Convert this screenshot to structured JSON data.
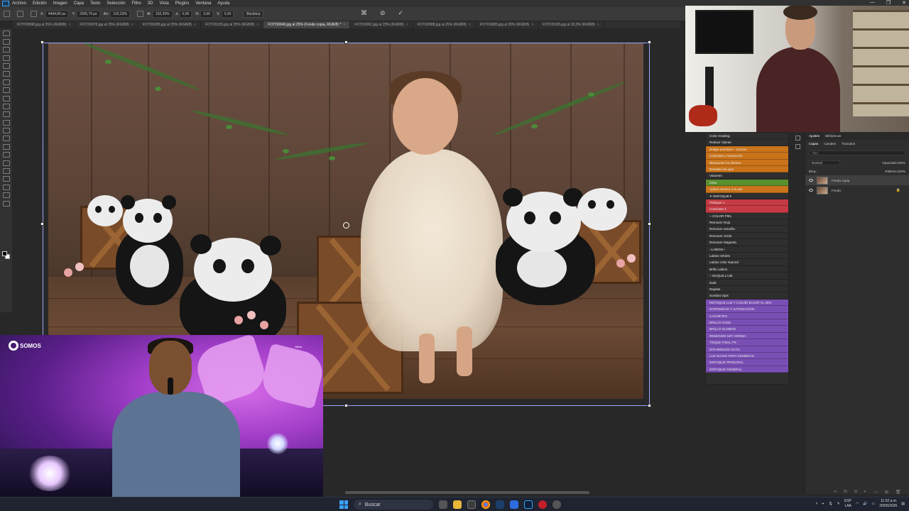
{
  "menu": [
    "Archivo",
    "Edición",
    "Imagen",
    "Capa",
    "Texto",
    "Selección",
    "Filtro",
    "3D",
    "Vista",
    "Plugins",
    "Ventana",
    "Ayuda"
  ],
  "window_controls": [
    "—",
    "❐",
    "✕"
  ],
  "options": {
    "x": "4494,80 px",
    "y": "2205,79 px",
    "w": "102,33%",
    "h": "102,33%",
    "angle": "0,00",
    "h_skew": "0,00",
    "v_skew": "0,00",
    "interp": "Bicúbica"
  },
  "tabs": [
    {
      "label": "FOTO9998.jpg al 25% (RGB/8)",
      "active": false
    },
    {
      "label": "FOTO0978.jpg al 25% (RGB/8)",
      "active": false
    },
    {
      "label": "FOTO0085.jpg al 25% (RGB/8)",
      "active": false
    },
    {
      "label": "FOTO0105.jpg al 25% (RGB/8)",
      "active": false
    },
    {
      "label": "FOTO0049.jpg al 25% (Fondo copia, RGB/8) *",
      "active": true
    },
    {
      "label": "FOTO0062.jpg al 25% (RGB/8)",
      "active": false
    },
    {
      "label": "FOTO0088.jpg al 25% (RGB/8)",
      "active": false
    },
    {
      "label": "FOTO0085.jpg al 25% (RGB/8)",
      "active": false
    },
    {
      "label": "FOTO0105.jpg al 33,3% (RGB/8)",
      "active": false
    }
  ],
  "actions": [
    {
      "label": "Color Grading",
      "color": "#2e2e2e"
    },
    {
      "label": "Reducir Ojeras",
      "color": "#2e2e2e"
    },
    {
      "label": "Dodge and Burn - Curvas",
      "color": "#c9731a"
    },
    {
      "label": "Contraste y Saturación",
      "color": "#c9731a"
    },
    {
      "label": "Blanquear los dientes",
      "color": "#c9731a"
    },
    {
      "label": "Resaltar los ojos",
      "color": "#c9731a"
    },
    {
      "label": "Volumen",
      "color": "#2e2e2e"
    },
    {
      "label": "Glow",
      "color": "#5a8f2e"
    },
    {
      "label": "Aplicar textura a la piel",
      "color": "#c9731a"
    },
    {
      "label": "✦ ENFOQUE✦",
      "color": "#2e2e2e"
    },
    {
      "label": "Pelisque 1",
      "color": "#c53a44"
    },
    {
      "label": "Contraste 2",
      "color": "#c53a44"
    },
    {
      "label": "~ COLOR PIEL",
      "color": "#2e2e2e"
    },
    {
      "label": "Remover Rojo",
      "color": "#2e2e2e"
    },
    {
      "label": "Remover amarillo",
      "color": "#2e2e2e"
    },
    {
      "label": "Remover verde",
      "color": "#2e2e2e"
    },
    {
      "label": "Remover Magenta",
      "color": "#2e2e2e"
    },
    {
      "label": "~LABIOS~",
      "color": "#2e2e2e"
    },
    {
      "label": "Labios Verdes",
      "color": "#2e2e2e"
    },
    {
      "label": "Labios color Natural",
      "color": "#2e2e2e"
    },
    {
      "label": "Brillo Labios",
      "color": "#2e2e2e"
    },
    {
      "label": "~ MAQUILLAJE",
      "color": "#2e2e2e"
    },
    {
      "label": "Dark",
      "color": "#2e2e2e"
    },
    {
      "label": "Rayitas",
      "color": "#2e2e2e"
    },
    {
      "label": "Sombra Ojos",
      "color": "#2e2e2e"
    },
    {
      "label": "RETOQUE LUZ Y COLOR BAJAR AL 30%",
      "color": "#7a4fb5"
    },
    {
      "label": "INTENSIDAD Y SATURACIÓN",
      "color": "#7a4fb5"
    },
    {
      "label": "CACHETES",
      "color": "#7a4fb5"
    },
    {
      "label": "BRILLO OJOS",
      "color": "#7a4fb5"
    },
    {
      "label": "BRILLO GLOBOS",
      "color": "#7a4fb5"
    },
    {
      "label": "REMOVER SET ARRIBA",
      "color": "#7a4fb5"
    },
    {
      "label": "TOQUE FINAL FR",
      "color": "#7a4fb5"
    },
    {
      "label": "DIFUMINADO SUTIL",
      "color": "#7a4fb5"
    },
    {
      "label": "LUZ SUAVE PARA SOMBRAS",
      "color": "#7a4fb5"
    },
    {
      "label": "ENFOQUE PRINCIPAL",
      "color": "#7a4fb5"
    },
    {
      "label": "ENFOQUE GENERAL",
      "color": "#7a4fb5"
    }
  ],
  "layers_panel": {
    "top_tabs": [
      "Ajustes",
      "Bibliotecas"
    ],
    "tabs": [
      "Capas",
      "Canales",
      "Trazados"
    ],
    "search_placeholder": "Tipo",
    "blend_mode": "Normal",
    "opacity_label": "Opacidad:",
    "opacity": "100%",
    "fill_label": "Relleno:",
    "fill": "100%",
    "lock_label": "Bloq.:",
    "layers": [
      {
        "name": "Fondo copia",
        "selected": true,
        "locked": false
      },
      {
        "name": "Fondo",
        "selected": false,
        "locked": true
      }
    ]
  },
  "tv": {
    "logo": "SOMOS",
    "corner": "latina"
  },
  "taskbar": {
    "search": "Buscar",
    "lang1": "ESP",
    "lang2": "LAA",
    "time": "11:02 a.m.",
    "date": "25/05/2026"
  }
}
